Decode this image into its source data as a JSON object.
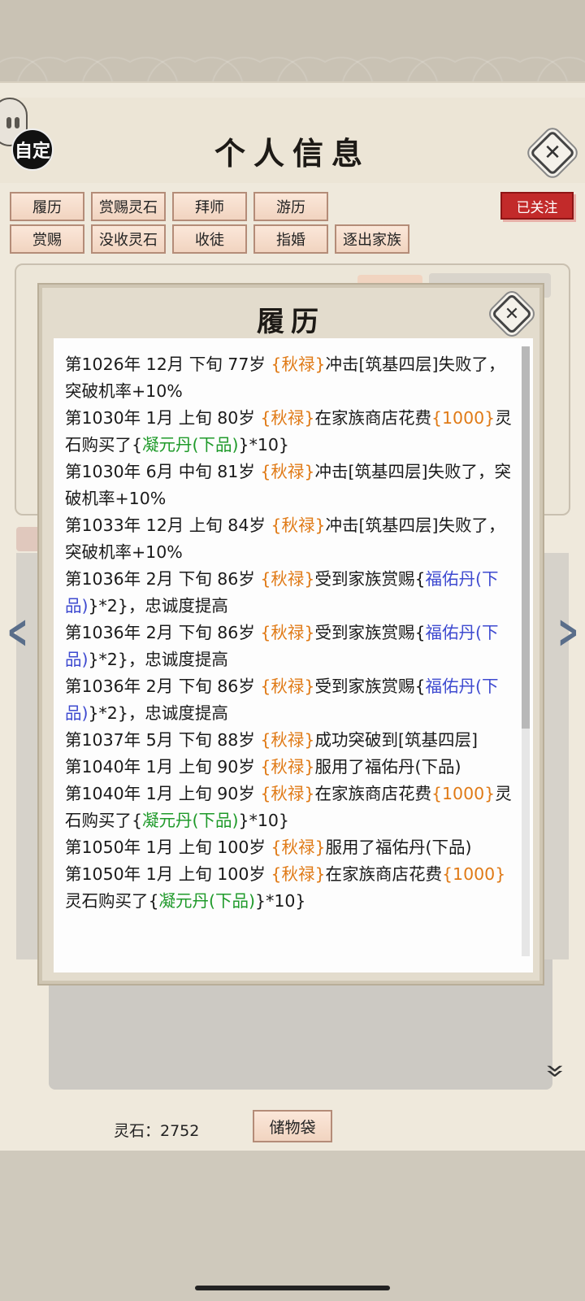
{
  "header": {
    "title": "个人信息",
    "auto_label": "自定",
    "follow_badge": "已关注"
  },
  "tabs_row1": [
    "履历",
    "赏赐灵石",
    "拜师",
    "游历"
  ],
  "tabs_row2": [
    "赏赐",
    "没收灵石",
    "收徒",
    "指婚",
    "逐出家族"
  ],
  "footer": {
    "stones_label": "灵石：2752",
    "bag_label": "储物袋"
  },
  "dialog": {
    "title": "履历",
    "entries": [
      [
        {
          "t": "第1026年 12月 下旬  77岁 "
        },
        {
          "t": "{秋禄}",
          "c": "nm"
        },
        {
          "t": "冲击[筑基四层]失败了，突破机率+10%"
        }
      ],
      [
        {
          "t": "第1030年  1月  上旬   80岁   "
        },
        {
          "t": "{秋禄}",
          "c": "nm"
        },
        {
          "t": "在家族商店花费"
        },
        {
          "t": "{1000}",
          "c": "nm"
        },
        {
          "t": "灵石购买了{"
        },
        {
          "t": "凝元丹(下品)",
          "c": "grn"
        },
        {
          "t": "}*10}"
        }
      ],
      [
        {
          "t": "第1030年  6月  中旬   81岁   "
        },
        {
          "t": "{秋禄}",
          "c": "nm"
        },
        {
          "t": "冲击[筑基四层]失败了，突破机率+10%"
        }
      ],
      [
        {
          "t": "第1033年 12月  上旬   84岁   "
        },
        {
          "t": "{秋禄}",
          "c": "nm"
        },
        {
          "t": "冲击[筑基四层]失败了，突破机率+10%"
        }
      ],
      [
        {
          "t": "第1036年  2月  下旬   86岁   "
        },
        {
          "t": "{秋禄}",
          "c": "nm"
        },
        {
          "t": "受到家族赏赐{"
        },
        {
          "t": "福佑丹(下品)",
          "c": "blu"
        },
        {
          "t": "}*2}，忠诚度提高"
        }
      ],
      [
        {
          "t": "第1036年  2月  下旬   86岁   "
        },
        {
          "t": "{秋禄}",
          "c": "nm"
        },
        {
          "t": "受到家族赏赐{"
        },
        {
          "t": "福佑丹(下品)",
          "c": "blu"
        },
        {
          "t": "}*2}，忠诚度提高"
        }
      ],
      [
        {
          "t": "第1036年  2月  下旬   86岁   "
        },
        {
          "t": "{秋禄}",
          "c": "nm"
        },
        {
          "t": "受到家族赏赐{"
        },
        {
          "t": "福佑丹(下品)",
          "c": "blu"
        },
        {
          "t": "}*2}，忠诚度提高"
        }
      ],
      [
        {
          "t": "第1037年 5月 下旬  88岁 "
        },
        {
          "t": "{秋禄}",
          "c": "nm"
        },
        {
          "t": "成功突破到[筑基四层]"
        }
      ],
      [
        {
          "t": "第1040年  1月  上旬   90岁  "
        },
        {
          "t": "{秋禄}",
          "c": "nm"
        },
        {
          "t": "服用了福佑丹(下品)"
        }
      ],
      [
        {
          "t": "第1040年  1月   上旬    90岁   "
        },
        {
          "t": "{秋禄}",
          "c": "nm"
        },
        {
          "t": "在家族商店花费"
        },
        {
          "t": "{1000}",
          "c": "nm"
        },
        {
          "t": "灵石购买了{"
        },
        {
          "t": "凝元丹(下品)",
          "c": "grn"
        },
        {
          "t": "}*10}"
        }
      ],
      [
        {
          "t": "第1050年  1月  上旬  100岁  "
        },
        {
          "t": "{秋禄}",
          "c": "nm"
        },
        {
          "t": "服用了福佑丹(下品)"
        }
      ],
      [
        {
          "t": "第1050年  1月   上旬    100岁    "
        },
        {
          "t": "{秋禄}",
          "c": "nm"
        },
        {
          "t": "在家族商店花费"
        },
        {
          "t": "{1000}",
          "c": "nm"
        },
        {
          "t": "灵石购买了{"
        },
        {
          "t": "凝元丹(下品)",
          "c": "grn"
        },
        {
          "t": "}*10}"
        }
      ]
    ]
  },
  "colors": {
    "name": "#e07a16",
    "item_green": "#1f9a2a",
    "item_blue": "#3e4ad0",
    "badge_red": "#c22a2a"
  },
  "icons": {
    "close": "close-icon",
    "prev": "chevron-left-icon",
    "next": "chevron-right-icon",
    "expand": "double-chevron-down-icon"
  }
}
